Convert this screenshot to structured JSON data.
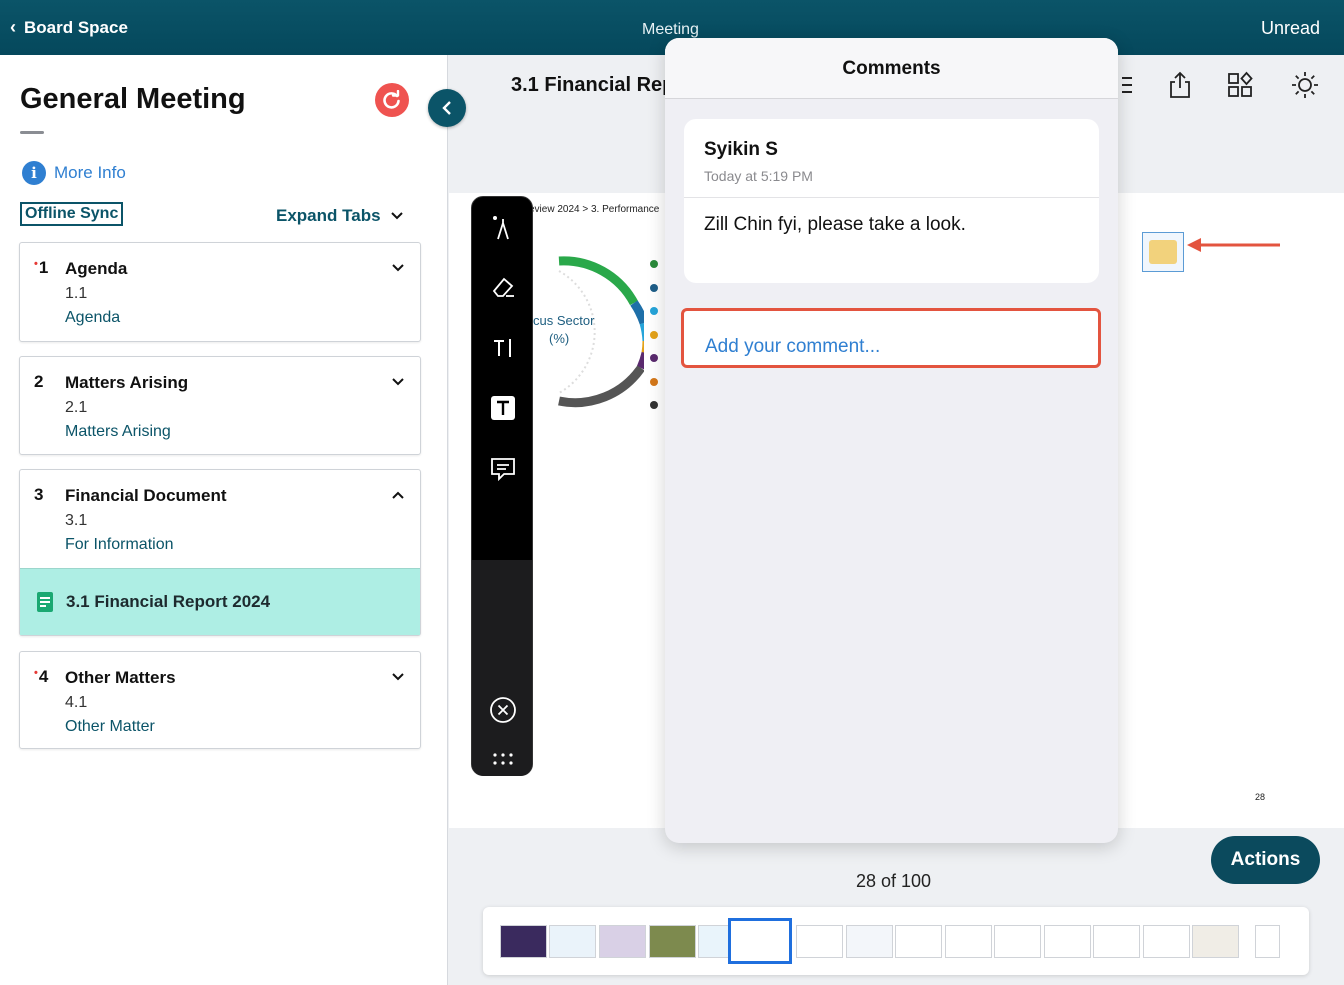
{
  "topbar": {
    "back_label": "Board Space",
    "center_label": "Meeting",
    "right_label": "Unread"
  },
  "sidebar": {
    "title": "General Meeting",
    "more_info": "More Info",
    "offline_sync": "Offline Sync",
    "expand_tabs": "Expand Tabs",
    "items": [
      {
        "num": "1",
        "dot": "•",
        "name": "Agenda",
        "sub": "1.1",
        "link": "Agenda"
      },
      {
        "num": "2",
        "name": "Matters Arising",
        "sub": "2.1",
        "link": "Matters Arising"
      },
      {
        "num": "3",
        "name": "Financial Document",
        "sub": "3.1",
        "link": "For Information",
        "doc": "3.1 Financial Report 2024"
      },
      {
        "num": "4",
        "dot": "•",
        "name": "Other Matters",
        "sub": "4.1",
        "link": "Other Matter"
      }
    ]
  },
  "document": {
    "title": "3.1 Financial Rep",
    "breadcrumb": "eview 2024 > 3. Performance",
    "chart_label_1": "cus Sector",
    "chart_label_2": "(%)",
    "page_number": "28"
  },
  "comments": {
    "header": "Comments",
    "author": "Syikin S",
    "time": "Today at 5:19 PM",
    "text": "Zill Chin fyi, please take a look.",
    "placeholder": "Add your comment..."
  },
  "footer": {
    "page_count": "28 of 100",
    "actions_label": "Actions"
  },
  "colors": {
    "brand": "#0b5468",
    "link": "#2f7fd1",
    "highlight": "#aeeee4",
    "alert": "#e3543f"
  }
}
